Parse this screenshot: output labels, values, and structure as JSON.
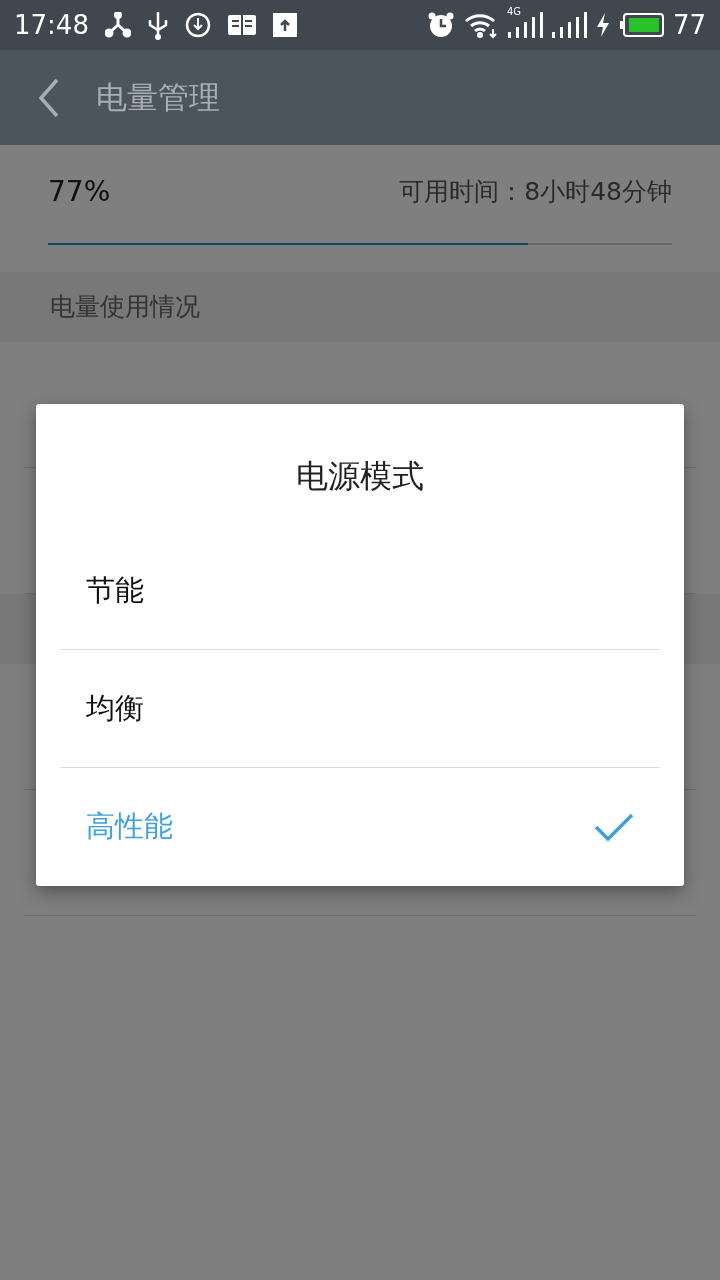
{
  "status_bar": {
    "time": "17:48",
    "network_label": "4G",
    "battery_text": "77"
  },
  "app_bar": {
    "title": "电量管理"
  },
  "battery": {
    "percent": "77%",
    "remaining": "可用时间：8小时48分钟",
    "level": 0.77
  },
  "sections": [
    {
      "header": "电量使用情况"
    }
  ],
  "dialog": {
    "title": "电源模式",
    "options": [
      {
        "label": "节能",
        "selected": false
      },
      {
        "label": "均衡",
        "selected": false
      },
      {
        "label": "高性能",
        "selected": true
      }
    ]
  }
}
